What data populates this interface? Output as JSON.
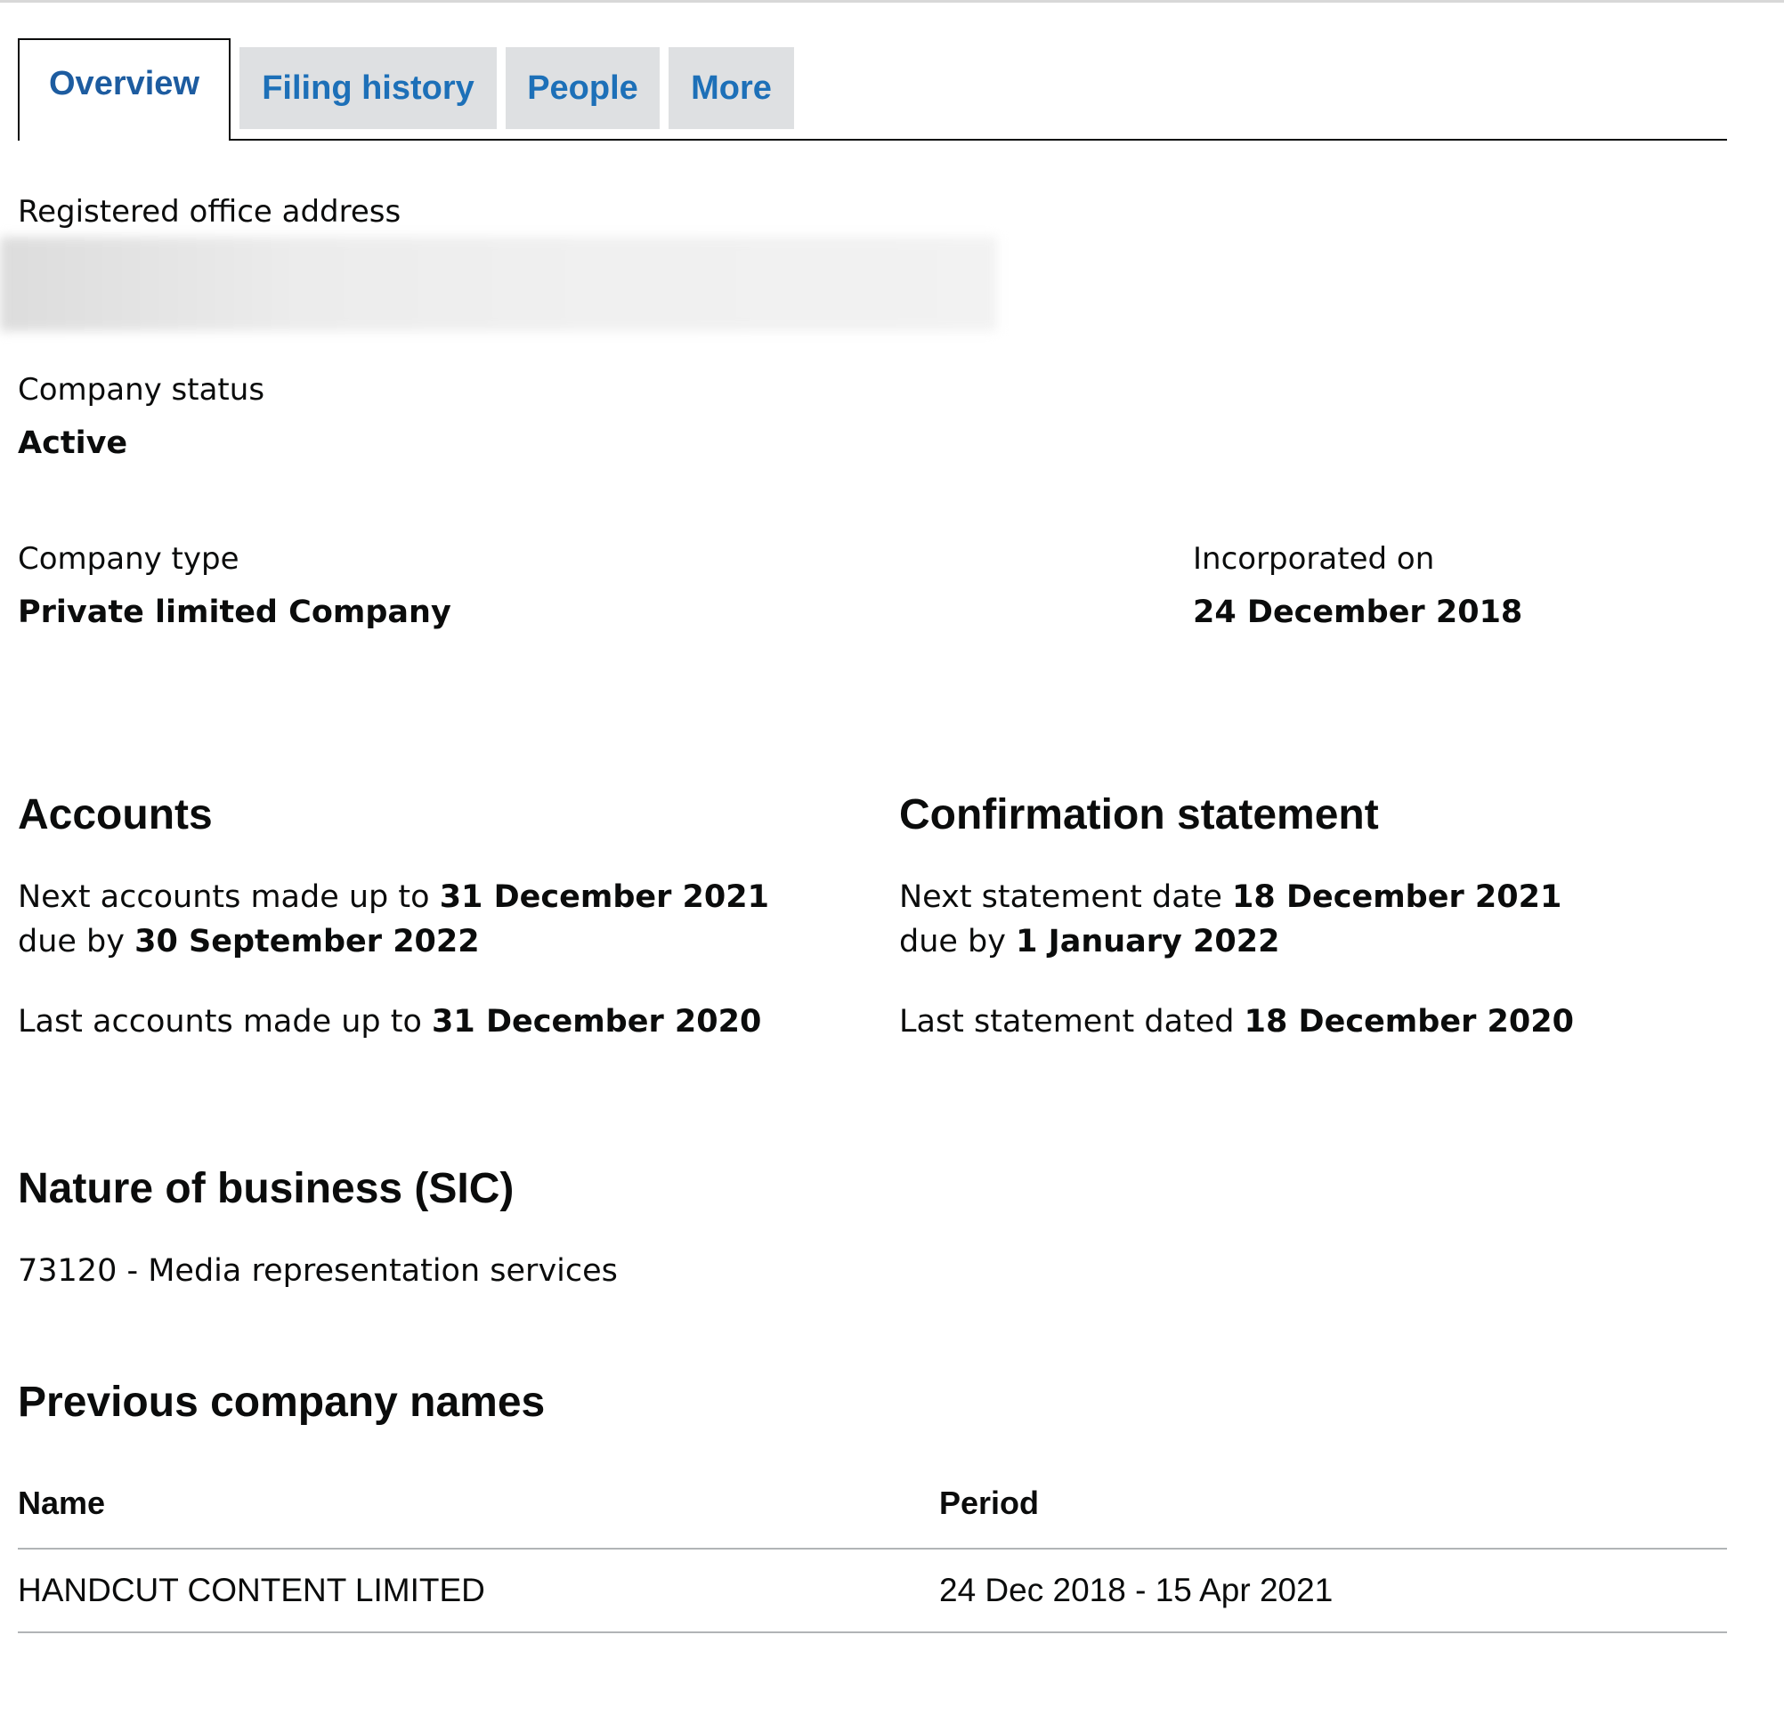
{
  "tabs": [
    {
      "label": "Overview",
      "active": true
    },
    {
      "label": "Filing history",
      "active": false
    },
    {
      "label": "People",
      "active": false
    },
    {
      "label": "More",
      "active": false
    }
  ],
  "overview": {
    "registered_office_label": "Registered office address",
    "company_status_label": "Company status",
    "company_status_value": "Active",
    "company_type_label": "Company type",
    "company_type_value": "Private limited Company",
    "incorporated_label": "Incorporated on",
    "incorporated_value": "24 December 2018"
  },
  "accounts": {
    "heading": "Accounts",
    "next_prefix": "Next accounts made up to",
    "next_date": "31 December 2021",
    "due_prefix": "due by",
    "due_date": "30 September 2022",
    "last_prefix": "Last accounts made up to",
    "last_date": "31 December 2020"
  },
  "confirmation": {
    "heading": "Confirmation statement",
    "next_prefix": "Next statement date",
    "next_date": "18 December 2021",
    "due_prefix": "due by",
    "due_date": "1 January 2022",
    "last_prefix": "Last statement dated",
    "last_date": "18 December 2020"
  },
  "sic": {
    "heading": "Nature of business (SIC)",
    "item": "73120 - Media representation services"
  },
  "previous_names": {
    "heading": "Previous company names",
    "columns": [
      "Name",
      "Period"
    ],
    "rows": [
      {
        "name": "HANDCUT CONTENT LIMITED",
        "period": "24 Dec 2018 - 15 Apr 2021"
      }
    ]
  },
  "colors": {
    "link": "#1d70b8",
    "tab_inactive_bg": "#dee0e2",
    "text": "#0b0c0c"
  }
}
